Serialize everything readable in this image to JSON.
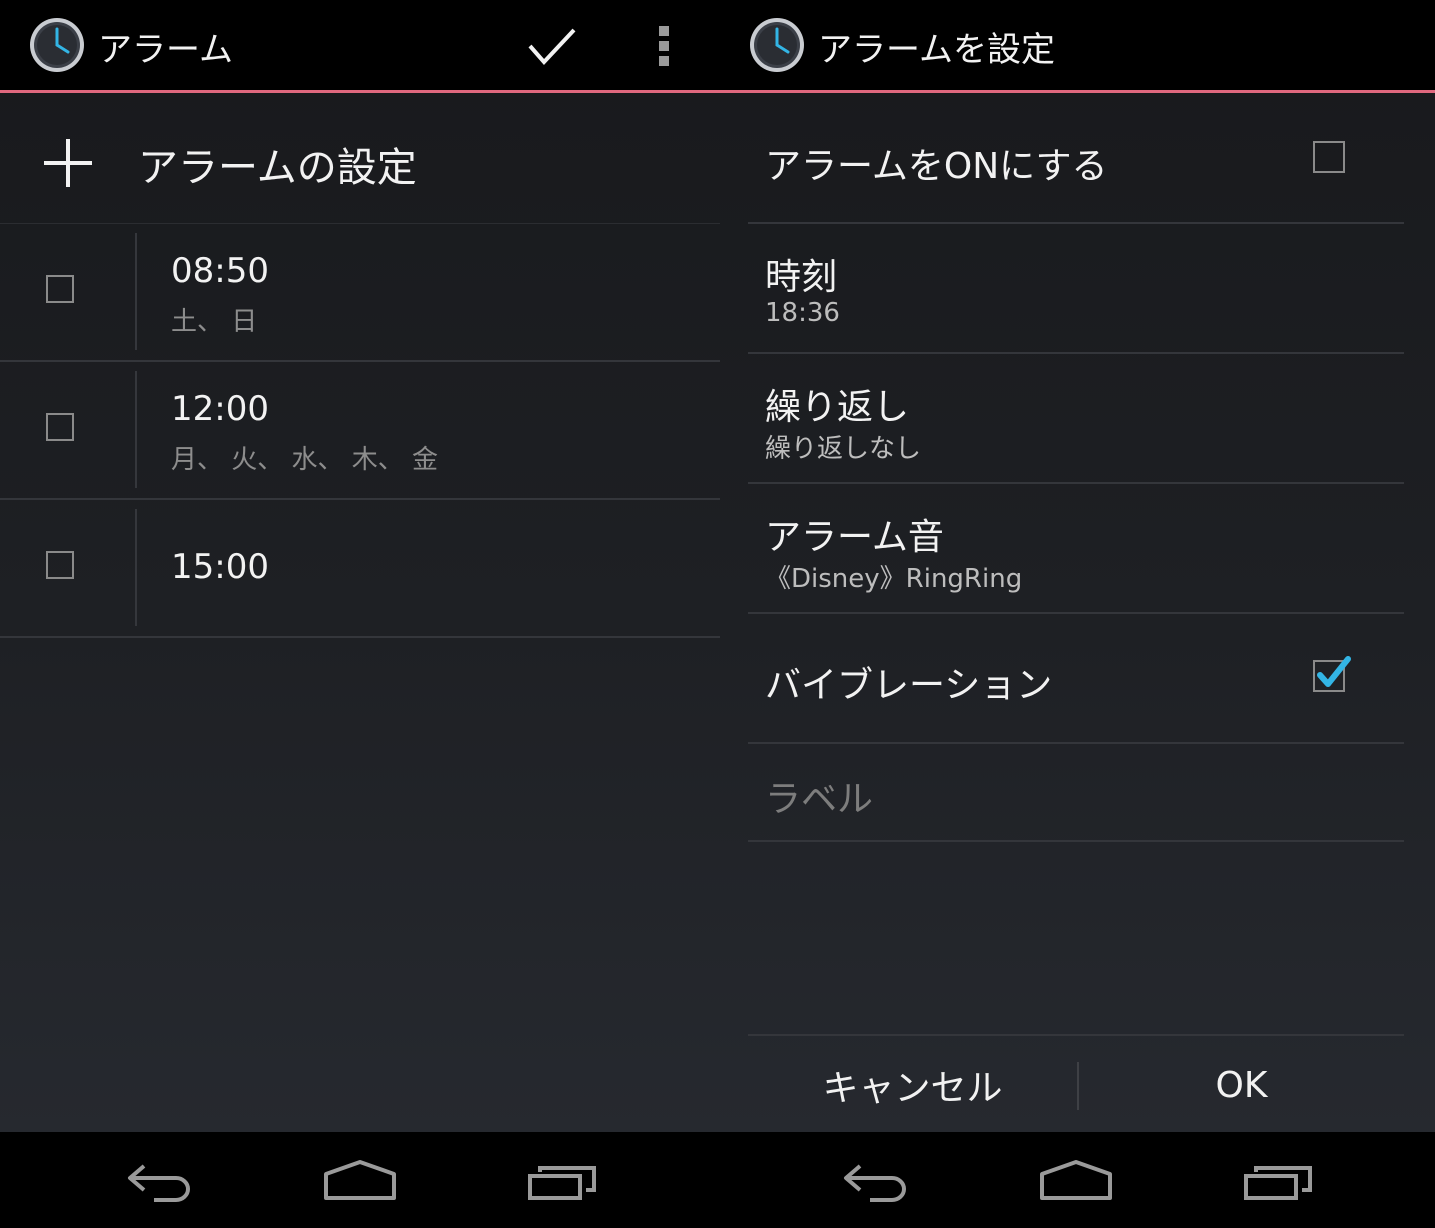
{
  "colors": {
    "accent": "#e0687e",
    "check_blue": "#33b5e5",
    "actionbar_bg": "#000000",
    "secondary_text": "#8d8d8d"
  },
  "left_screen": {
    "actionbar": {
      "title": "アラーム",
      "icons": [
        "clock-icon",
        "checkmark-icon",
        "overflow-menu-icon"
      ]
    },
    "add_alarm_label": "アラームの設定",
    "alarms": [
      {
        "time": "08:50",
        "days": "土、 日",
        "enabled": false
      },
      {
        "time": "12:00",
        "days": "月、 火、 水、 木、 金",
        "enabled": false
      },
      {
        "time": "15:00",
        "days": "",
        "enabled": false
      }
    ]
  },
  "right_screen": {
    "actionbar": {
      "title": "アラームを設定"
    },
    "settings": {
      "enable": {
        "title": "アラームをONにする",
        "checked": false
      },
      "time": {
        "title": "時刻",
        "value": "18:36"
      },
      "repeat": {
        "title": "繰り返し",
        "value": "繰り返しなし"
      },
      "ringtone": {
        "title": "アラーム音",
        "value": "《Disney》RingRing"
      },
      "vibrate": {
        "title": "バイブレーション",
        "checked": true
      },
      "label": {
        "placeholder": "ラベル"
      }
    },
    "buttons": {
      "cancel": "キャンセル",
      "ok": "OK"
    }
  },
  "navbar": {
    "icons": [
      "back-icon",
      "home-icon",
      "recent-apps-icon"
    ]
  }
}
